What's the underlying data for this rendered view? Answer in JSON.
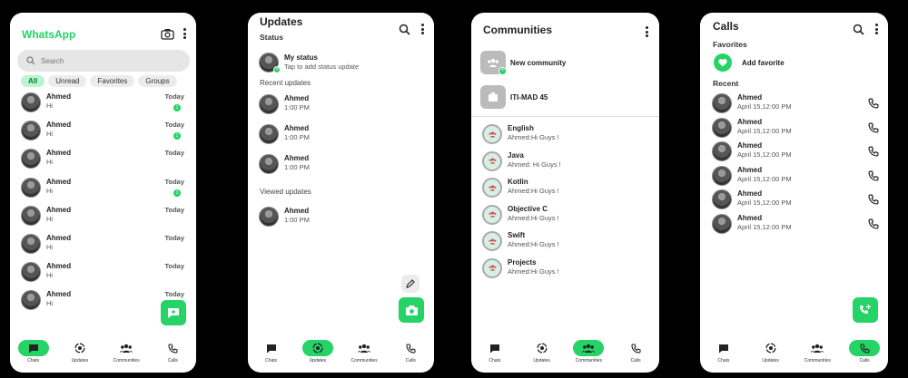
{
  "chats_screen": {
    "title": "WhatsApp",
    "search_placeholder": "Search",
    "filters": [
      "All",
      "Unread",
      "Favorites",
      "Groups"
    ],
    "rows": [
      {
        "name": "Ahmed",
        "msg": "Hi",
        "time": "Today",
        "badge": "1"
      },
      {
        "name": "Ahmed",
        "msg": "Hi",
        "time": "Today",
        "badge": "1"
      },
      {
        "name": "Ahmed",
        "msg": "Hi",
        "time": "Today",
        "badge": ""
      },
      {
        "name": "Ahmed",
        "msg": "Hi",
        "time": "Today",
        "badge": "1"
      },
      {
        "name": "Ahmed",
        "msg": "Hi",
        "time": "Today",
        "badge": ""
      },
      {
        "name": "Ahmed",
        "msg": "Hi",
        "time": "Today",
        "badge": ""
      },
      {
        "name": "Ahmed",
        "msg": "Hi",
        "time": "Today",
        "badge": ""
      },
      {
        "name": "Ahmed",
        "msg": "Hi",
        "time": "Today",
        "badge": ""
      }
    ]
  },
  "updates_screen": {
    "title": "Updates",
    "status_label": "Status",
    "my_status": "My status",
    "my_status_hint": "Tap to add status update",
    "recent_label": "Recent updates",
    "recent": [
      {
        "name": "Ahmed",
        "time": "1:00 PM"
      },
      {
        "name": "Ahmed",
        "time": "1:00 PM"
      },
      {
        "name": "Ahmed",
        "time": "1:00 PM"
      }
    ],
    "viewed_label": "Viewed updates",
    "viewed": [
      {
        "name": "Ahmed",
        "time": "1:00 PM"
      }
    ]
  },
  "communities_screen": {
    "title": "Communities",
    "new_community": "New community",
    "community_name": "ITI-MAD 45",
    "groups": [
      {
        "name": "English",
        "msg": "Ahmed:Hi Guys !"
      },
      {
        "name": "Java",
        "msg": "Ahmed: Hi Guys !"
      },
      {
        "name": "Kotlin",
        "msg": "Ahmed:Hi Guys !"
      },
      {
        "name": "Objective C",
        "msg": "Ahmed:Hi Guys !"
      },
      {
        "name": "Swift",
        "msg": "Ahmed:Hi Guys !"
      },
      {
        "name": "Projects",
        "msg": "Ahmed:Hi Guys !"
      }
    ]
  },
  "calls_screen": {
    "title": "Calls",
    "favorites_label": "Favorites",
    "add_favorite": "Add favorite",
    "recent_label": "Recent",
    "calls": [
      {
        "name": "Ahmed",
        "time": "April 15,12:00 PM"
      },
      {
        "name": "Ahmed",
        "time": "April 15,12:00 PM"
      },
      {
        "name": "Ahmed",
        "time": "April 15,12:00 PM"
      },
      {
        "name": "Ahmed",
        "time": "April 15,12:00 PM"
      },
      {
        "name": "Ahmed",
        "time": "April 15,12:00 PM"
      },
      {
        "name": "Ahmed",
        "time": "April 15,12:00 PM"
      }
    ]
  },
  "nav": {
    "chats": "Chats",
    "updates": "Updates",
    "communities": "Communities",
    "calls": "Calls"
  },
  "colors": {
    "accent": "#25d366",
    "background": "#000000"
  }
}
